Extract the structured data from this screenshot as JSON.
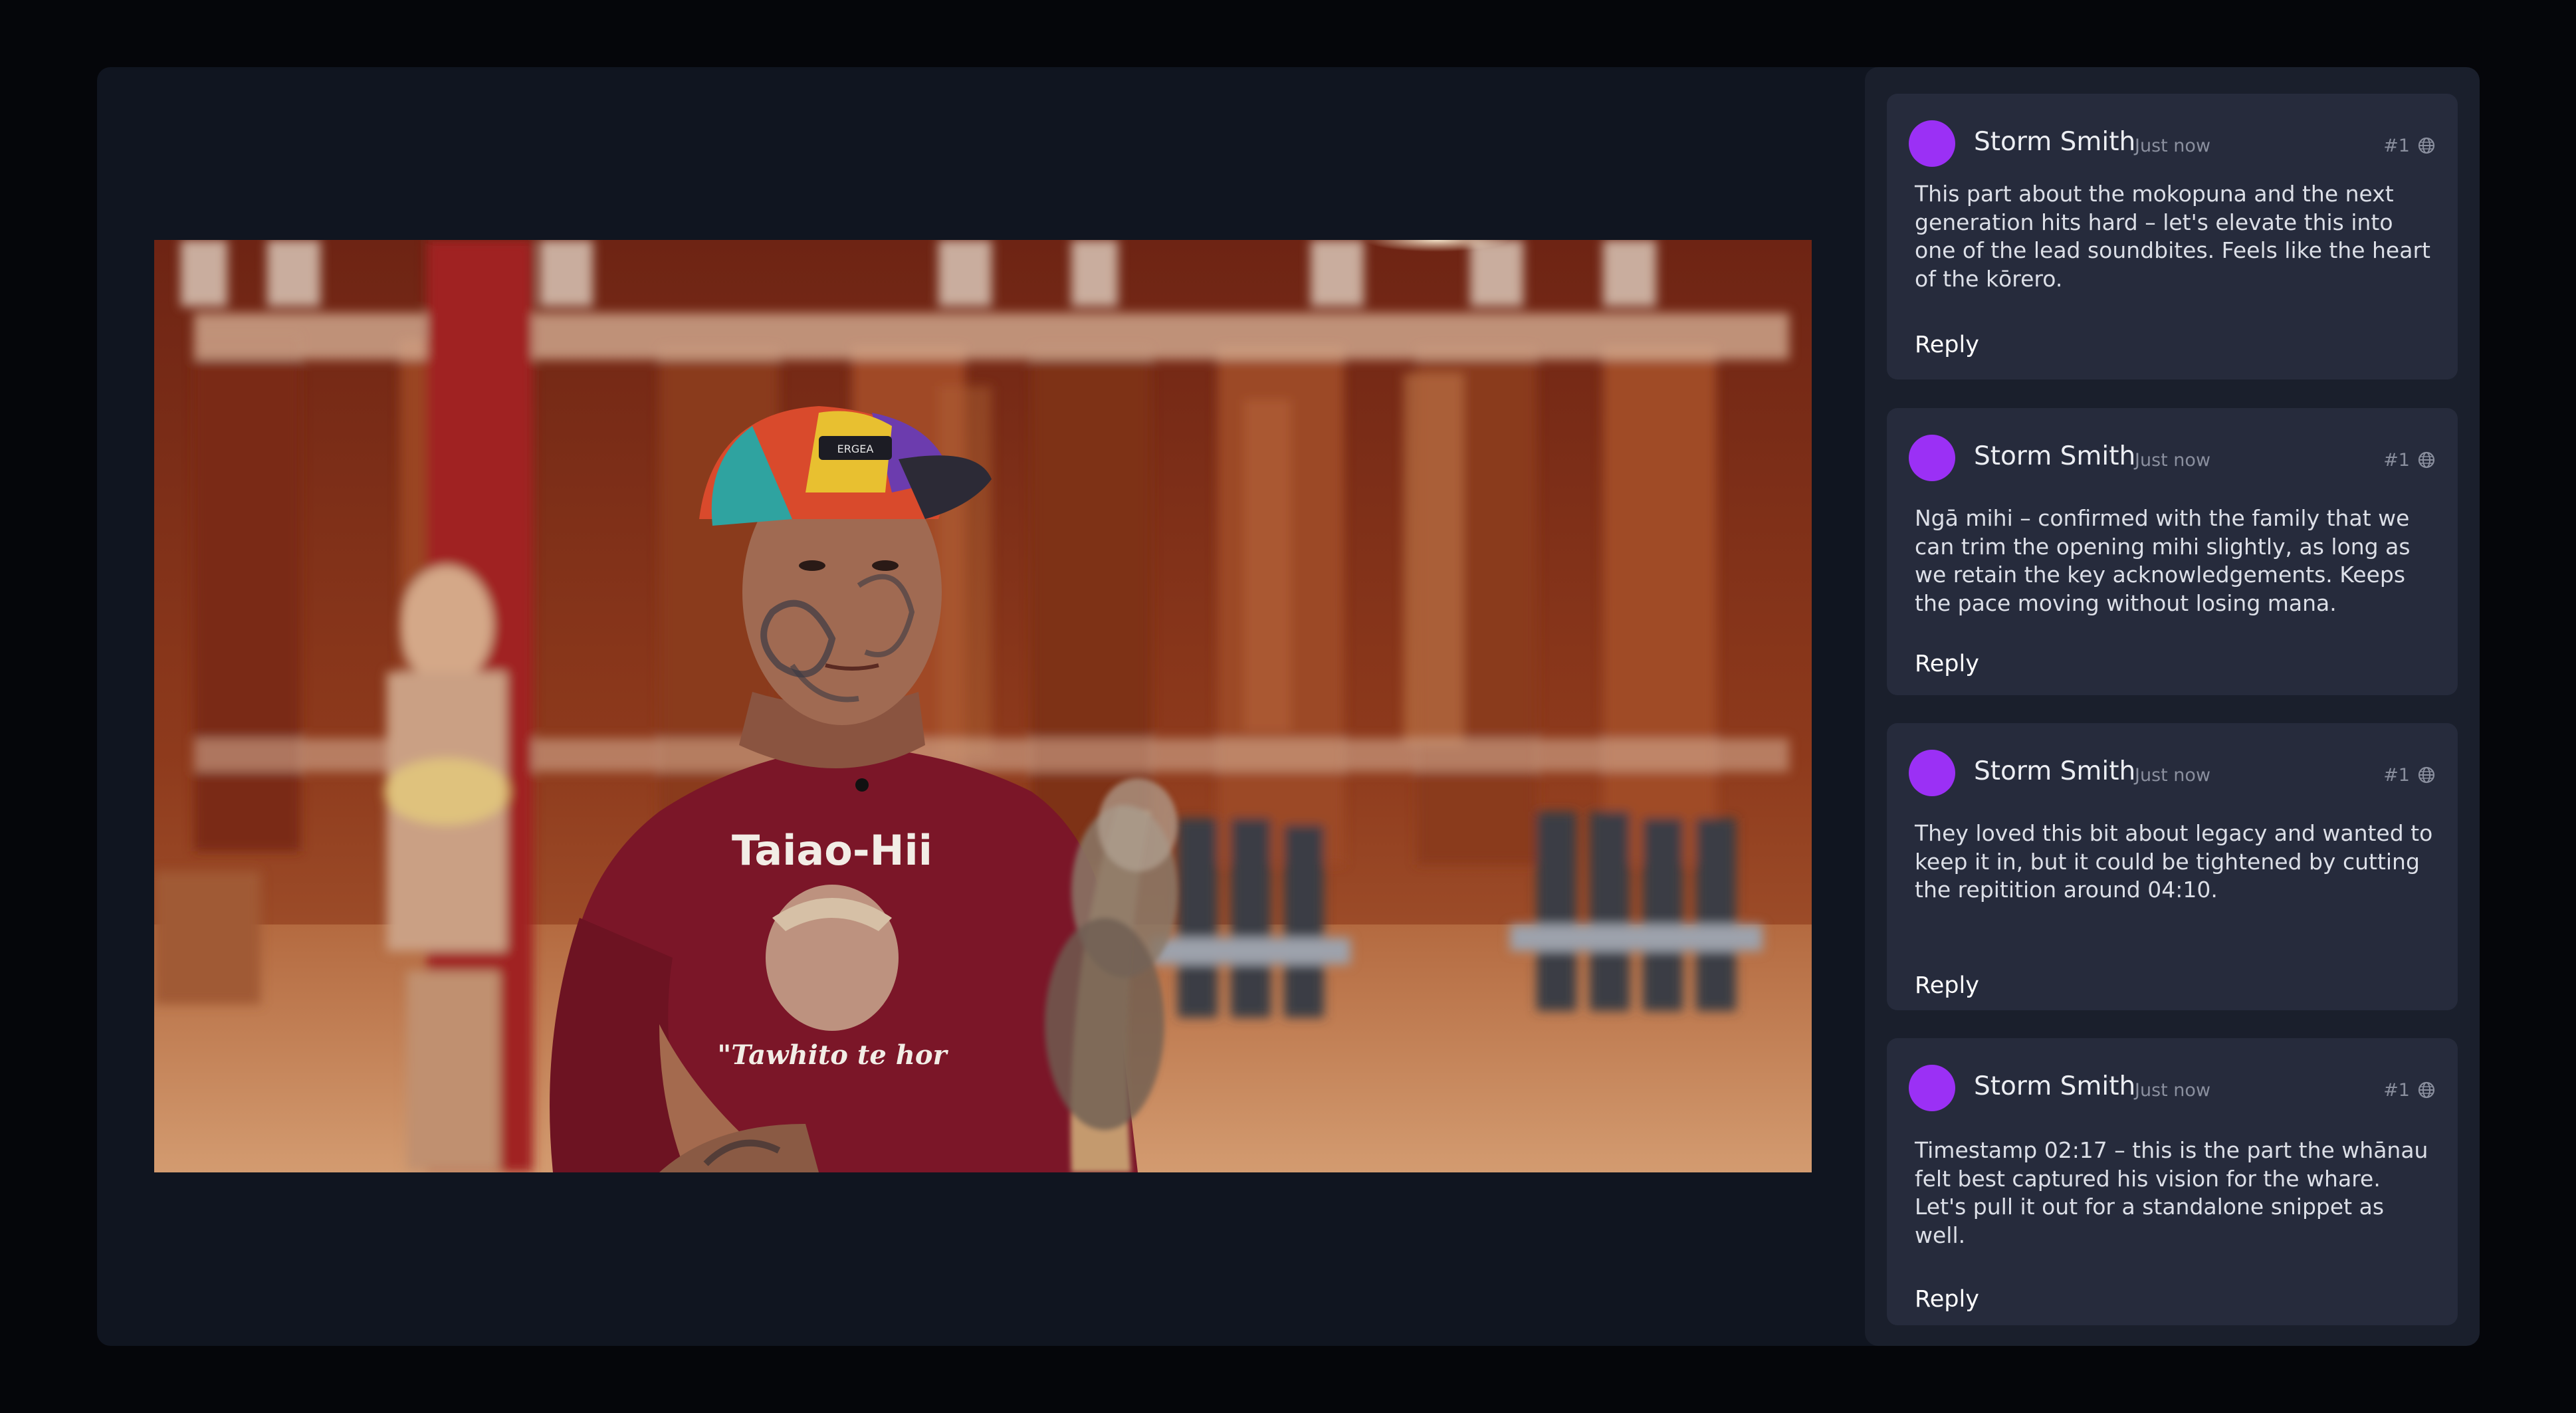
{
  "video": {
    "shirt_text_top": "Taiao-Hii",
    "shirt_text_bottom": "\"Tawhito te hor",
    "cap_logo": "ERGEA"
  },
  "colors": {
    "avatar": "#9b30f5",
    "panel": "#262b3c",
    "sidebar": "#1a1f2c",
    "app_bg": "#101520"
  },
  "comments": [
    {
      "author": "Storm Smith",
      "time": "Just now",
      "num": "#1",
      "icon": "globe-icon",
      "text": "This part about the mokopuna and the next generation hits hard – let's elevate this into one of the lead soundbites. Feels like the heart of the kōrero.",
      "reply": "Reply"
    },
    {
      "author": "Storm Smith",
      "time": "Just now",
      "num": "#1",
      "icon": "globe-icon",
      "text": "Ngā mihi – confirmed with the family that we can trim the opening mihi slightly, as long as we retain the key acknowledgements. Keeps the pace moving without losing mana.",
      "reply": "Reply"
    },
    {
      "author": "Storm Smith",
      "time": "Just now",
      "num": "#1",
      "icon": "globe-icon",
      "text": "They loved this bit about legacy and wanted to keep it in, but it could be tightened by cutting the repitition around 04:10.",
      "reply": "Reply"
    },
    {
      "author": "Storm Smith",
      "time": "Just now",
      "num": "#1",
      "icon": "globe-icon",
      "text": "Timestamp 02:17 – this is the part the whānau felt best captured his vision for the whare. Let's pull it out for a standalone snippet as well.",
      "reply": "Reply"
    }
  ]
}
